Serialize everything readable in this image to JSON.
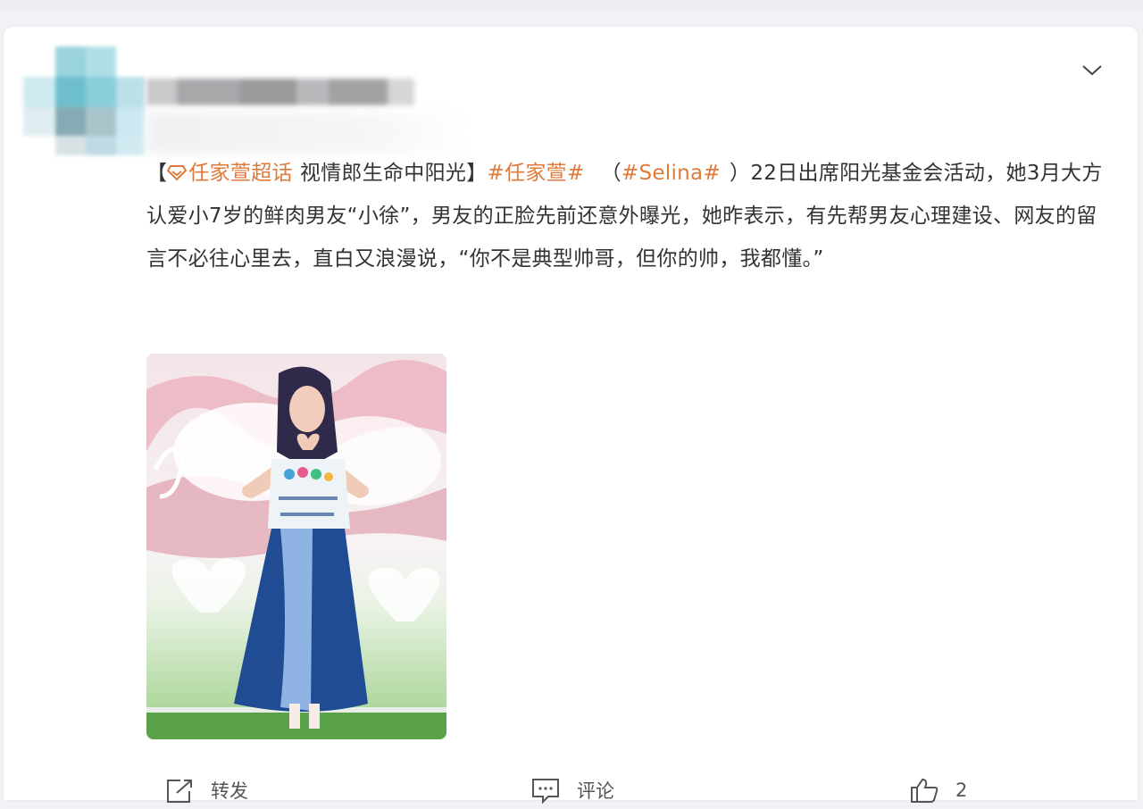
{
  "post": {
    "bracket_open": "【",
    "super_topic": "任家萱超话",
    "headline": "视情郎生命中阳光】",
    "topic1": "#任家萱#",
    "paren_open": "（",
    "topic2": "#Selina#",
    "body": "）22日出席阳光基金会活动，她3月大方认爱小7岁的鲜肉男友“小徐”，男友的正脸先前还意外曝光，她昨表示，有先帮男友心理建设、网友的留言不必往心里去，直白又浪漫说，“你不是典型帅哥，但你的帅，我都懂。”"
  },
  "actions": {
    "repost_label": "转发",
    "comment_label": "评论",
    "like_count": "2"
  },
  "icons": {
    "expand": "chevron-down-icon",
    "super_topic": "diamond-icon",
    "repost": "repost-icon",
    "comment": "comment-icon",
    "like": "thumbs-up-icon"
  },
  "colors": {
    "topic": "#e07a3a",
    "text": "#333333"
  }
}
